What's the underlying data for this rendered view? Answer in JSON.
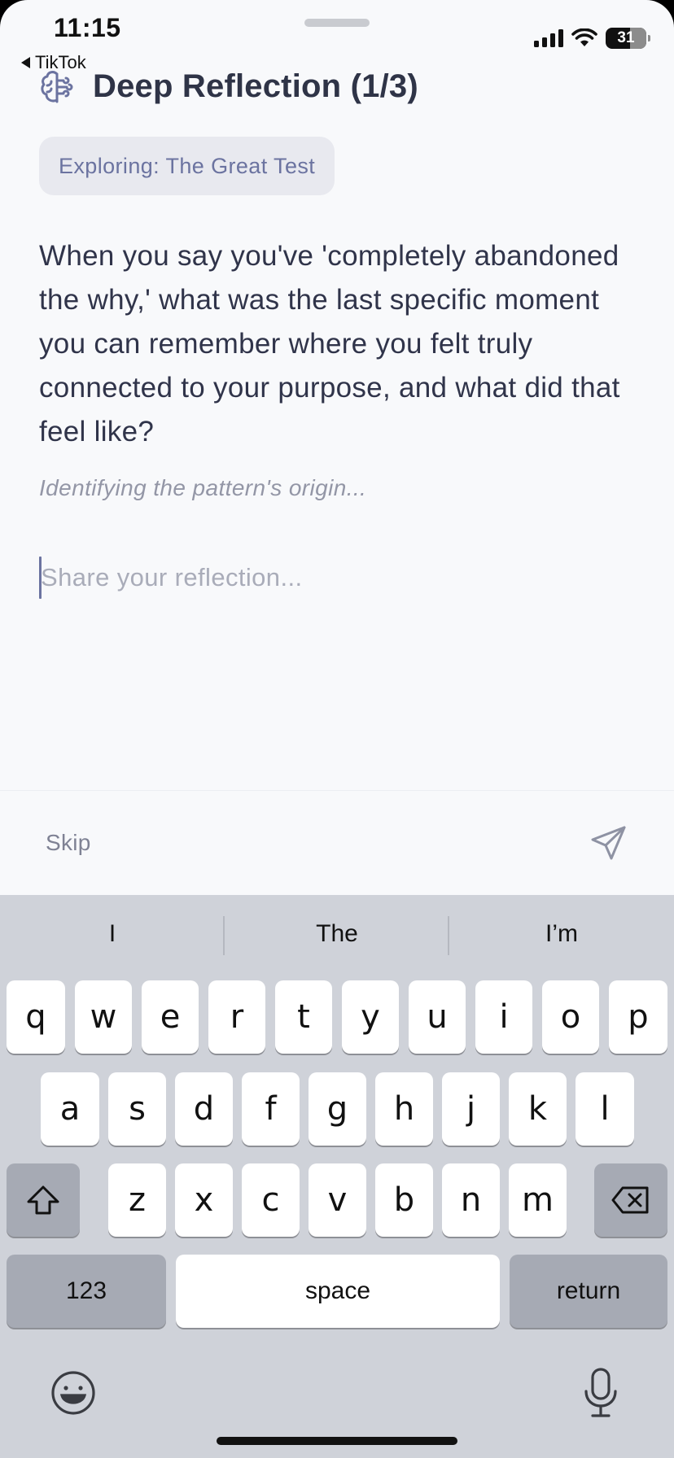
{
  "status_bar": {
    "time": "11:15",
    "back_app": "TikTok",
    "battery": "31"
  },
  "header": {
    "icon": "brain-icon",
    "title": "Deep Reflection (1/3)"
  },
  "topic_chip": "Exploring: The Great Test",
  "question": "When you say you've 'completely abandoned the why,' what was the last specific moment you can remember where you felt truly connected to your purpose, and what did that feel like?",
  "hint": "Identifying the pattern's origin...",
  "input": {
    "placeholder": "Share your reflection...",
    "value": ""
  },
  "footer": {
    "skip_label": "Skip",
    "send_icon": "send-icon"
  },
  "keyboard": {
    "suggestions": [
      "I",
      "The",
      "I’m"
    ],
    "row1": [
      "q",
      "w",
      "e",
      "r",
      "t",
      "y",
      "u",
      "i",
      "o",
      "p"
    ],
    "row2": [
      "a",
      "s",
      "d",
      "f",
      "g",
      "h",
      "j",
      "k",
      "l"
    ],
    "row3": [
      "z",
      "x",
      "c",
      "v",
      "b",
      "n",
      "m"
    ],
    "numbers_label": "123",
    "space_label": "space",
    "return_label": "return"
  },
  "colors": {
    "background": "#f8f9fb",
    "accent": "#6b73a0",
    "text": "#30344a",
    "keyboard": "#cfd2d9"
  }
}
